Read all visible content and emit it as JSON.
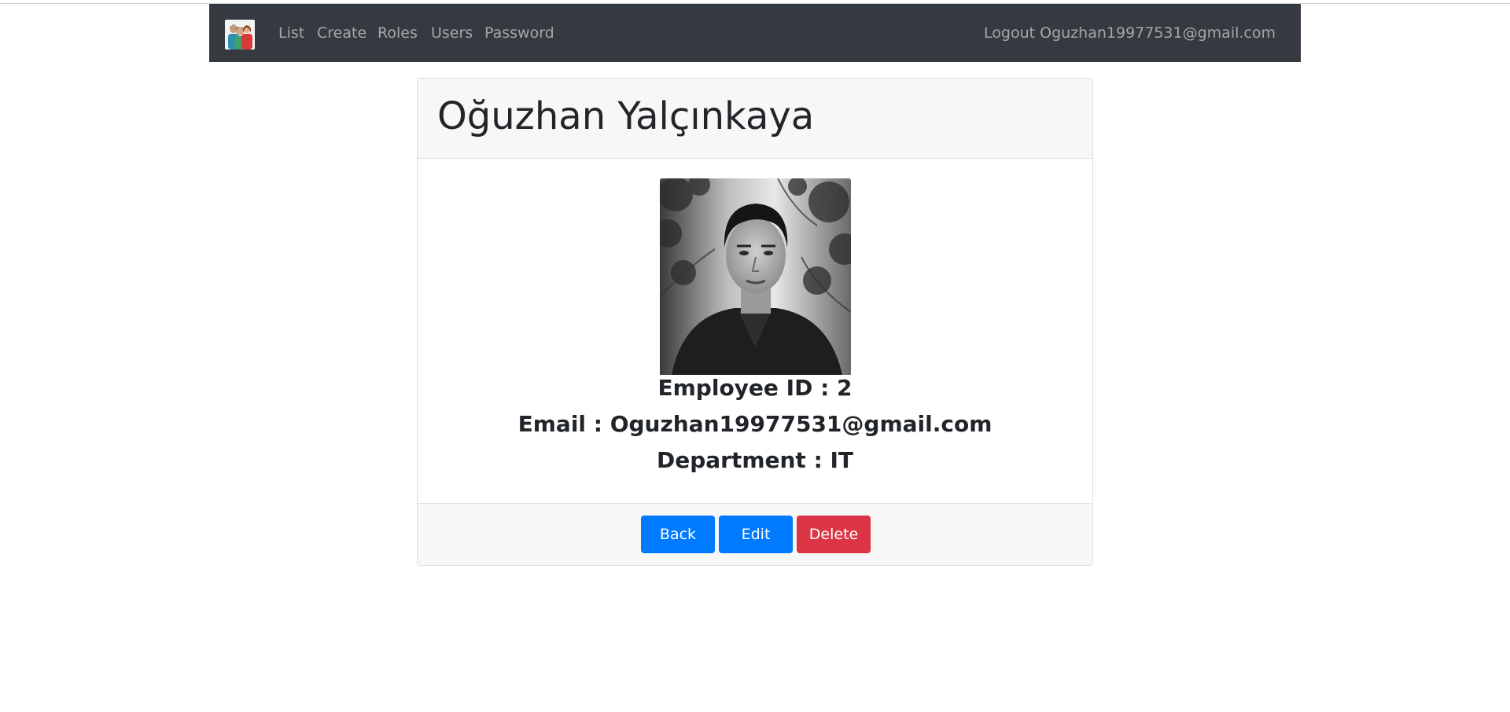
{
  "navbar": {
    "brand_icon": "employees-logo-icon",
    "links": [
      "List",
      "Create",
      "Roles",
      "Users",
      "Password"
    ],
    "logout_label": "Logout Oguzhan19977531@gmail.com"
  },
  "employee": {
    "name": "Oğuzhan Yalçınkaya",
    "photo_icon": "employee-photo",
    "employee_id_line": "Employee ID : 2",
    "email_line": "Email : Oguzhan19977531@gmail.com",
    "department_line": "Department : IT"
  },
  "actions": {
    "back_label": "Back",
    "edit_label": "Edit",
    "delete_label": "Delete"
  },
  "colors": {
    "navbar_bg": "#343a40",
    "primary": "#007bff",
    "danger": "#dc3545"
  }
}
